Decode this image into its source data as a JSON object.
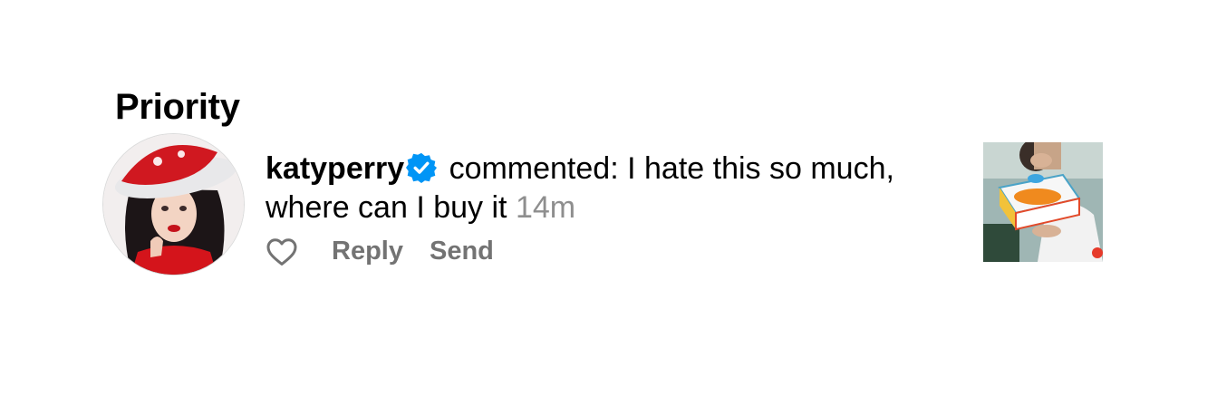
{
  "section": {
    "title": "Priority"
  },
  "notification": {
    "avatar_icon": "profile-photo",
    "username": "katyperry",
    "verified_icon": "verified-badge-icon",
    "action_text": "commented:",
    "comment": "I hate this so much, where can I buy it",
    "timestamp": "14m",
    "like_icon": "heart-outline-icon",
    "reply_label": "Reply",
    "send_label": "Send",
    "thumbnail_icon": "post-thumbnail"
  },
  "colors": {
    "verified_blue": "#0095f6",
    "muted_text": "#8e8e8e",
    "action_text": "#737373",
    "text": "#000000",
    "background": "#ffffff"
  }
}
